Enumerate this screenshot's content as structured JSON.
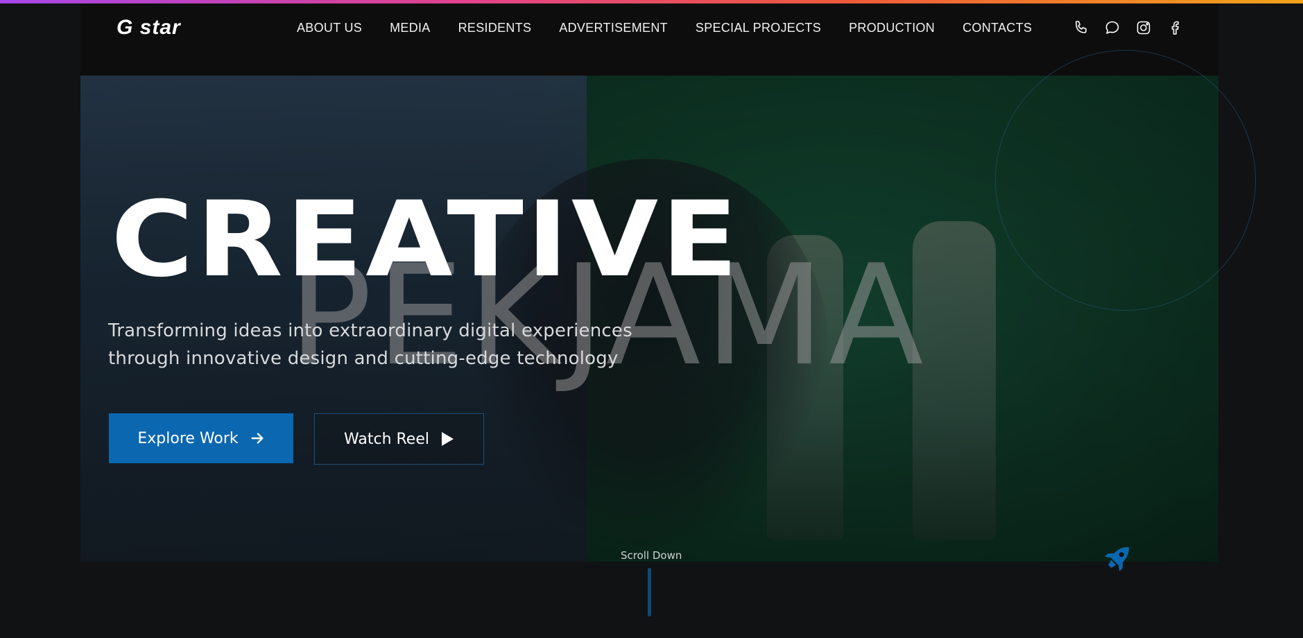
{
  "brand": {
    "logo": "G star"
  },
  "nav": {
    "items": [
      {
        "label": "ABOUT US"
      },
      {
        "label": "MEDIA"
      },
      {
        "label": "RESIDENTS"
      },
      {
        "label": "ADVERTISEMENT"
      },
      {
        "label": "SPECIAL PROJECTS"
      },
      {
        "label": "PRODUCTION"
      },
      {
        "label": "CONTACTS"
      }
    ],
    "icons": [
      "phone-icon",
      "chat-icon",
      "instagram-icon",
      "facebook-icon"
    ]
  },
  "hero": {
    "background_word": "PEKJAMA",
    "title": "CREATIVE",
    "subtitle_line1": "Transforming ideas into extraordinary digital experiences",
    "subtitle_line2": "through innovative design and cutting-edge technology",
    "primary_button": "Explore Work",
    "secondary_button": "Watch Reel"
  },
  "scroll": {
    "label": "Scroll Down"
  },
  "colors": {
    "accent": "#0b67b0",
    "background": "#0c0c0d",
    "gradient_start": "#a646e8",
    "gradient_end": "#f2a31a"
  }
}
